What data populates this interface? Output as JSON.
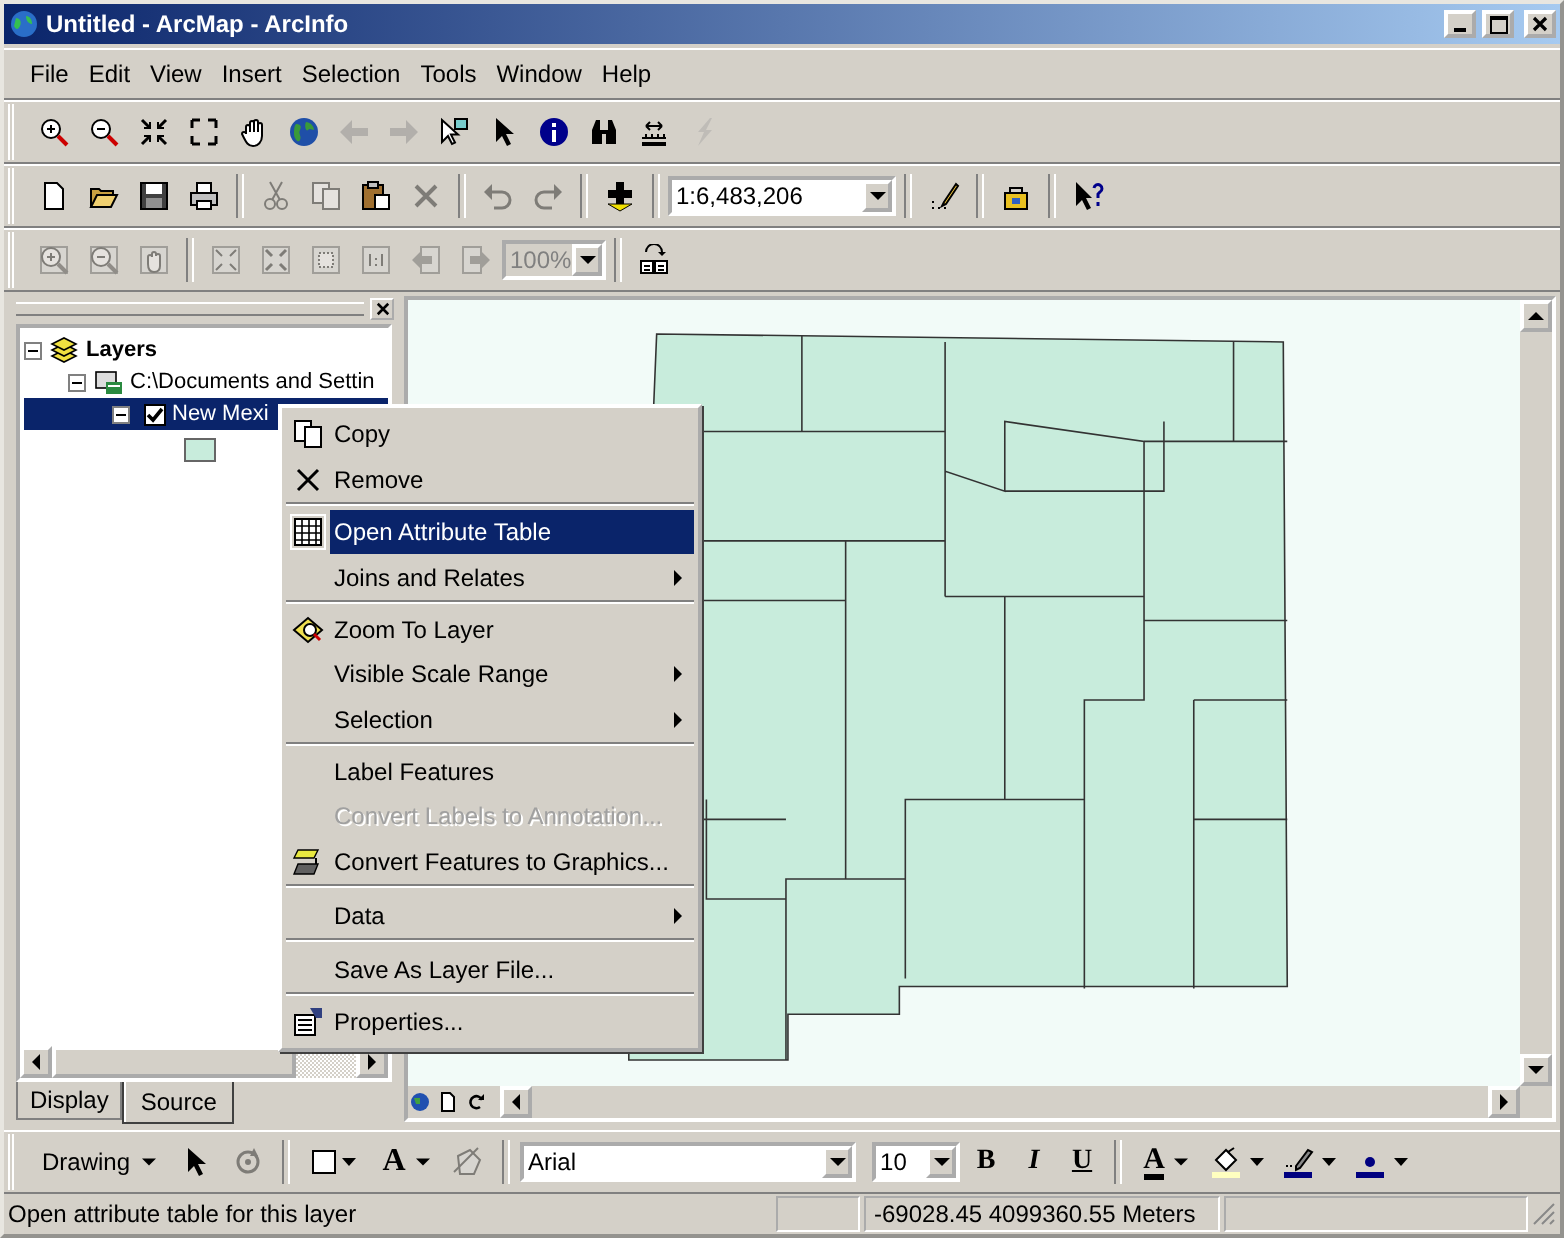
{
  "window": {
    "title": "Untitled - ArcMap - ArcInfo"
  },
  "menu_bar": [
    "File",
    "Edit",
    "View",
    "Insert",
    "Selection",
    "Tools",
    "Window",
    "Help"
  ],
  "tools_toolbar": {
    "buttons": [
      {
        "disabled": false
      },
      {
        "disabled": false
      },
      {
        "disabled": false
      },
      {
        "disabled": false
      },
      {
        "disabled": false
      },
      {
        "disabled": false
      },
      {
        "disabled": true
      },
      {
        "disabled": true
      },
      {
        "disabled": false
      },
      {
        "disabled": false
      },
      {
        "disabled": false
      },
      {
        "disabled": false
      },
      {
        "disabled": false
      },
      {
        "disabled": true
      }
    ]
  },
  "standard_toolbar": {
    "buttons": [
      {
        "disabled": false
      },
      {
        "disabled": false
      },
      {
        "disabled": false
      },
      {
        "disabled": false
      },
      {
        "disabled": true
      },
      {
        "disabled": true
      },
      {
        "disabled": false
      },
      {
        "disabled": true
      },
      {
        "disabled": true
      },
      {
        "disabled": true
      },
      {
        "disabled": false
      },
      {
        "disabled": false
      },
      {
        "disabled": false
      },
      {
        "disabled": false
      }
    ],
    "scale": {
      "value": "1:6,483,206"
    }
  },
  "layout_toolbar": {
    "buttons": [
      {
        "disabled": true
      },
      {
        "disabled": true
      },
      {
        "disabled": true
      },
      {
        "disabled": true
      },
      {
        "disabled": true
      },
      {
        "disabled": true
      },
      {
        "disabled": true
      },
      {
        "disabled": true
      },
      {
        "disabled": true
      },
      {
        "disabled": false
      }
    ],
    "zoom": {
      "value": "100%",
      "disabled": true
    }
  },
  "table_of_contents": {
    "tree": [
      {
        "label": "Layers",
        "kind": "group",
        "expanded": true,
        "children": [
          {
            "label": "C:\\Documents and Settin",
            "kind": "workspace",
            "expanded": true,
            "children": [
              {
                "label": "New Mexi",
                "kind": "layer",
                "expanded": true,
                "checked": true,
                "selected": true,
                "children": [
                  {
                    "kind": "symbol",
                    "color": "#c8ecdc"
                  }
                ]
              }
            ]
          }
        ]
      }
    ],
    "tabs": [
      {
        "label": "Display",
        "selected": false
      },
      {
        "label": "Source",
        "selected": true
      }
    ]
  },
  "context_menu": [
    {
      "label": "Copy",
      "selected": false,
      "disabled": false,
      "submenu": false,
      "separator_after": false
    },
    {
      "label": "Remove",
      "selected": false,
      "disabled": false,
      "submenu": false,
      "separator_after": true
    },
    {
      "label": "Open Attribute Table",
      "selected": true,
      "disabled": false,
      "submenu": false,
      "separator_after": false
    },
    {
      "label": "Joins and Relates",
      "selected": false,
      "disabled": false,
      "submenu": true,
      "separator_after": true
    },
    {
      "label": "Zoom To Layer",
      "selected": false,
      "disabled": false,
      "submenu": false,
      "separator_after": false
    },
    {
      "label": "Visible Scale Range",
      "selected": false,
      "disabled": false,
      "submenu": true,
      "separator_after": false
    },
    {
      "label": "Selection",
      "selected": false,
      "disabled": false,
      "submenu": true,
      "separator_after": true
    },
    {
      "label": "Label Features",
      "selected": false,
      "disabled": false,
      "submenu": false,
      "separator_after": false
    },
    {
      "label": "Convert Labels to Annotation...",
      "selected": false,
      "disabled": true,
      "submenu": false,
      "separator_after": false
    },
    {
      "label": "Convert Features to Graphics...",
      "selected": false,
      "disabled": false,
      "submenu": false,
      "separator_after": true
    },
    {
      "label": "Data",
      "selected": false,
      "disabled": false,
      "submenu": true,
      "separator_after": true
    },
    {
      "label": "Save As Layer File...",
      "selected": false,
      "disabled": false,
      "submenu": false,
      "separator_after": true
    },
    {
      "label": "Properties...",
      "selected": false,
      "disabled": false,
      "submenu": false,
      "separator_after": false
    }
  ],
  "drawing_toolbar": {
    "menu_label": "Drawing",
    "select_tool": {
      "disabled": false
    },
    "rotate_tool": {
      "disabled": true
    },
    "rectangle_tool": {
      "disabled": false
    },
    "text_tool": {
      "label": "A"
    },
    "edit_vertices_tool": {
      "disabled": true
    },
    "font": {
      "value": "Arial"
    },
    "size": {
      "value": "10"
    },
    "bold": {
      "label": "B"
    },
    "italic": {
      "label": "I"
    },
    "underline": {
      "label": "U"
    },
    "font_color": {
      "label": "A"
    }
  },
  "status_bar": {
    "message": "Open attribute table for this layer",
    "coordinates": "-69028.45  4099360.55 Meters"
  }
}
